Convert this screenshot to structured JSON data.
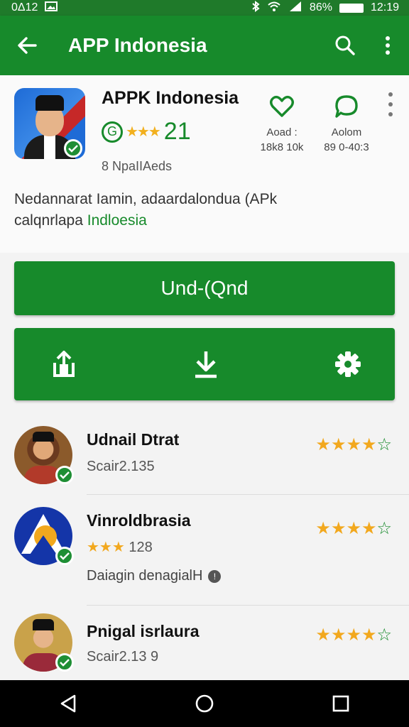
{
  "status_bar": {
    "time_left": "0Δ12",
    "battery_pct": "86%",
    "clock": "12:19"
  },
  "app_bar": {
    "title": "APP Indonesia"
  },
  "app": {
    "name": "APPK Indonesia",
    "rating_score": "21",
    "downloads_label": "8 NpaIIAeds",
    "description_main": "Nedannarat Iamin, adaardalondua (APk",
    "description_line2_prefix": "calqnrlapa ",
    "description_highlight": "Indloesia",
    "actions": [
      {
        "label": "Aoad :",
        "sub": "18k8 10k"
      },
      {
        "label": "Aolom",
        "sub": "89 0-40:3"
      }
    ]
  },
  "primary_button": {
    "label": "Und-(Qnd"
  },
  "colors": {
    "brand_green": "#178a2b",
    "star_gold": "#f2a81e",
    "dark_status": "#1f7a2a"
  },
  "list_items": [
    {
      "title": "Udnail Dtrat",
      "subtitle": "Scair2.135",
      "rating": 4
    },
    {
      "title": "Vinroldbrasia",
      "subtitle_value": "128",
      "extra": "Daiagin denagialH",
      "rating": 4
    },
    {
      "title": "Pnigal isrlaura",
      "subtitle": "Scair2.13 9",
      "rating": 4
    }
  ],
  "icons": {
    "back": "arrow-left-icon",
    "search": "search-icon",
    "more": "more-vert-icon",
    "heart": "heart-icon",
    "chat": "chat-bubble-icon",
    "share": "share-icon",
    "download": "download-icon",
    "settings": "gear-icon"
  }
}
